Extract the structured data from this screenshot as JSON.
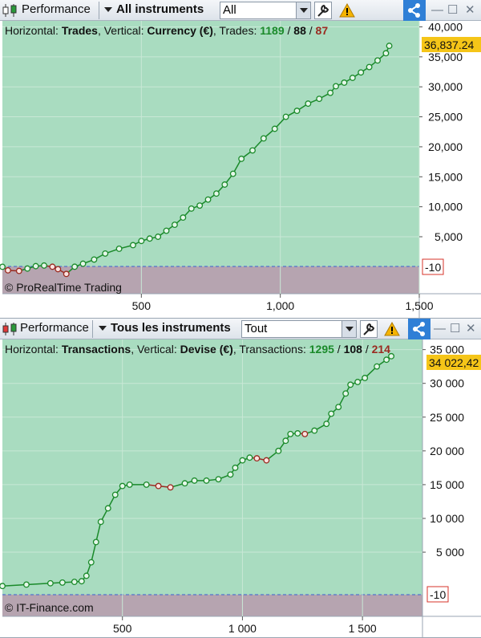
{
  "colors": {
    "up": "#1a8a2a",
    "down": "#9a2a20",
    "profit_zone": "#a9dcc0",
    "loss_zone": "#b6a4b0",
    "current_badge": "#f5c518",
    "zero_badge_text": "#d7332a",
    "share": "#2f7fd6"
  },
  "top": {
    "toolbar": {
      "title": "Performance",
      "scope": "All instruments",
      "filter": "All"
    },
    "info": {
      "h_label": "Horizontal: ",
      "h_value": "Trades",
      "v_label": ", Vertical: ",
      "v_value": "Currency (€)",
      "count_label": ", Trades: ",
      "total": "1189",
      "sep1": " / ",
      "neutral": "88",
      "sep2": " / ",
      "losing": "87"
    },
    "watermark": "© ProRealTime Trading",
    "current_value_label": "36,837.24",
    "zero_label": "-10"
  },
  "bottom": {
    "toolbar": {
      "title": "Performance",
      "scope": "Tous les instruments",
      "filter": "Tout"
    },
    "info": {
      "h_label": "Horizontal: ",
      "h_value": "Transactions",
      "v_label": ", Vertical: ",
      "v_value": "Devise (€)",
      "count_label": ", Transactions: ",
      "total": "1295",
      "sep1": " / ",
      "neutral": "108",
      "sep2": " / ",
      "losing": "214"
    },
    "watermark": "© IT-Finance.com",
    "current_value_label": "34 022,42",
    "zero_label": "-10"
  },
  "chart_data": [
    {
      "type": "line",
      "xlabel": "Trades",
      "ylabel": "Currency (€)",
      "xlim": [
        0,
        1500
      ],
      "ylim": [
        -4500,
        41000
      ],
      "x_ticks": [
        500,
        1000,
        1500
      ],
      "x_tick_labels": [
        "500",
        "1,000",
        "1,500"
      ],
      "y_ticks": [
        5000,
        10000,
        15000,
        20000,
        25000,
        30000,
        35000,
        40000
      ],
      "y_tick_labels": [
        "5,000",
        "10,000",
        "15,000",
        "20,000",
        "25,000",
        "30,000",
        "35,000",
        "40,000"
      ],
      "current_value": 36837.24,
      "series": [
        {
          "x": [
            0,
            20,
            60,
            90,
            120,
            150,
            180,
            200,
            230,
            260,
            290,
            330,
            370,
            420,
            470,
            500,
            530,
            560,
            590,
            620,
            650,
            680,
            710,
            740,
            770,
            800,
            830,
            860,
            900,
            940,
            980,
            1020,
            1060,
            1100,
            1140,
            1180,
            1200,
            1230,
            1260,
            1290,
            1320,
            1350,
            1380,
            1392
          ],
          "y": [
            -10,
            -600,
            -700,
            -300,
            100,
            200,
            0,
            -400,
            -1200,
            0,
            500,
            1200,
            2200,
            3000,
            3600,
            4300,
            4700,
            5000,
            6000,
            7000,
            8200,
            9700,
            10200,
            11200,
            12200,
            13700,
            15500,
            18000,
            19400,
            21400,
            23000,
            25000,
            26000,
            27200,
            28000,
            29000,
            30100,
            30700,
            31500,
            32400,
            33300,
            34400,
            35600,
            36837
          ]
        }
      ]
    },
    {
      "type": "line",
      "xlabel": "Transactions",
      "ylabel": "Devise (€)",
      "xlim": [
        0,
        1750
      ],
      "ylim": [
        -4500,
        36500
      ],
      "x_ticks": [
        500,
        1000,
        1500
      ],
      "x_tick_labels": [
        "500",
        "1 000",
        "1 500"
      ],
      "y_ticks": [
        5000,
        10000,
        15000,
        20000,
        25000,
        30000,
        35000
      ],
      "y_tick_labels": [
        "5 000",
        "10 000",
        "15 000",
        "20 000",
        "25 000",
        "30 000",
        "35 000"
      ],
      "current_value": 34022.42,
      "series": [
        {
          "x": [
            0,
            100,
            200,
            250,
            300,
            330,
            350,
            370,
            390,
            410,
            440,
            470,
            500,
            530,
            600,
            650,
            700,
            760,
            800,
            850,
            900,
            950,
            970,
            1000,
            1030,
            1060,
            1100,
            1150,
            1180,
            1200,
            1230,
            1260,
            1300,
            1350,
            1370,
            1400,
            1430,
            1450,
            1480,
            1510,
            1560,
            1600,
            1620
          ],
          "y": [
            -10,
            200,
            400,
            500,
            600,
            700,
            1500,
            3500,
            6500,
            9500,
            11500,
            13500,
            14800,
            15000,
            15000,
            14800,
            14600,
            15200,
            15600,
            15600,
            15800,
            16500,
            17500,
            18600,
            19000,
            18900,
            18600,
            20000,
            21500,
            22500,
            22600,
            22500,
            23000,
            24000,
            25500,
            26500,
            28500,
            29800,
            30200,
            30800,
            32500,
            33500,
            34022
          ]
        }
      ]
    }
  ]
}
